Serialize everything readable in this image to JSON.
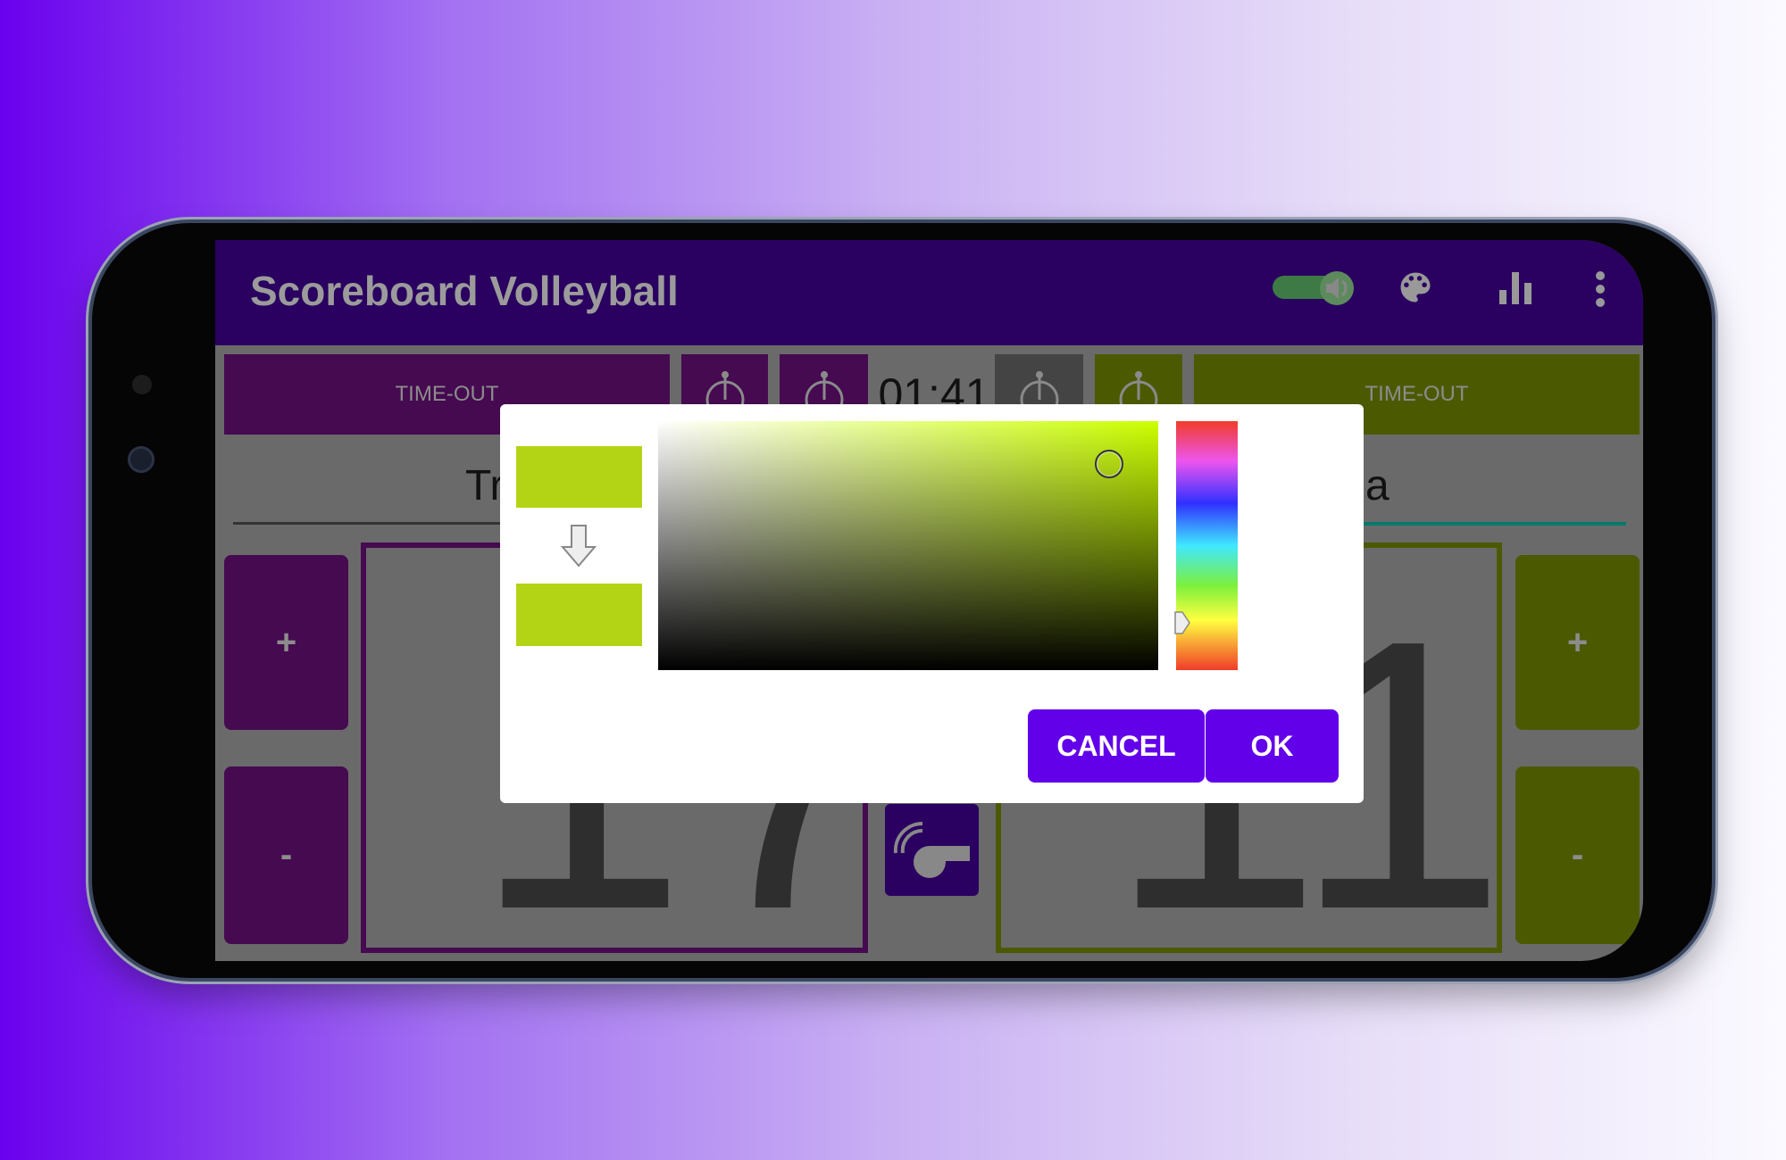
{
  "app": {
    "title": "Scoreboard Volleyball",
    "toolbar_icons": [
      "sound-toggle-icon",
      "palette-icon",
      "stats-bar-chart-icon",
      "more-vert-icon"
    ]
  },
  "scoreboard": {
    "left": {
      "timeout_label": "TIME-OUT",
      "team_name": "Tr",
      "score": "17",
      "plus": "+",
      "minus": "-",
      "color": "#450a50"
    },
    "right": {
      "timeout_label": "TIME-OUT",
      "team_name": "a",
      "score": "11",
      "plus": "+",
      "minus": "-",
      "color": "#4b5a00"
    },
    "timer": "01:41"
  },
  "color_picker": {
    "old_color": "#b3d414",
    "new_color": "#b3d414",
    "hue_color": "#ccff00",
    "cancel_label": "CANCEL",
    "ok_label": "OK",
    "accent": "#6200ea"
  }
}
